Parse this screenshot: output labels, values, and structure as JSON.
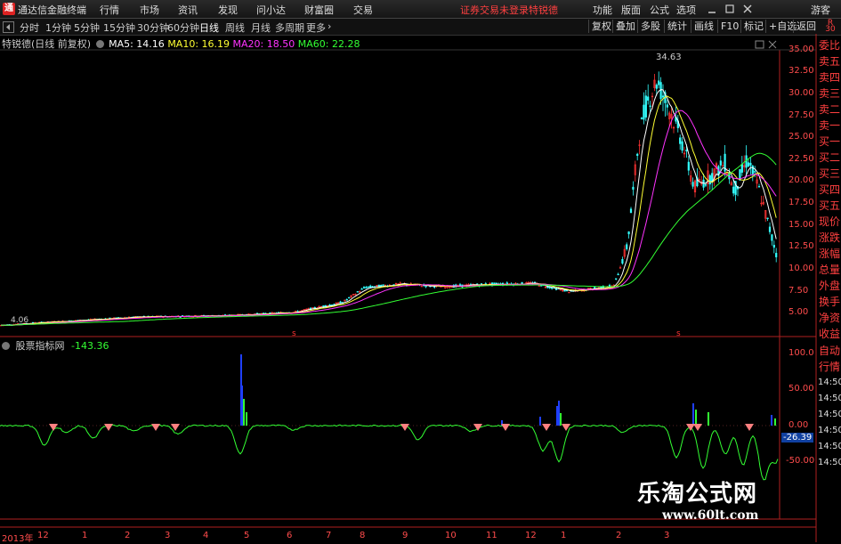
{
  "app": {
    "title": "通达信金融终端",
    "logo_char": "通"
  },
  "menu": {
    "items": [
      "行情",
      "市场",
      "资讯",
      "发现",
      "问小达",
      "财富圈",
      "交易"
    ],
    "notice": "证券交易未登录",
    "stock_name": "特锐德",
    "right_items": [
      "功能",
      "版面",
      "公式",
      "选项",
      "游客"
    ]
  },
  "periods": {
    "items": [
      "分时",
      "1分钟",
      "5分钟",
      "15分钟",
      "30分钟",
      "60分钟",
      "日线",
      "周线",
      "月线",
      "多周期",
      "更多"
    ],
    "selected": "日线"
  },
  "toolbar_right": [
    "复权",
    "叠加",
    "多股",
    "统计",
    "画线",
    "F10",
    "标记",
    "+自选",
    "返回"
  ],
  "main_chart": {
    "title": "特锐德(日线 前复权)",
    "indicators": [
      {
        "label": "MA5: 14.16",
        "color": "#ffffff"
      },
      {
        "label": "MA10: 16.19",
        "color": "#ffff33"
      },
      {
        "label": "MA20: 18.50",
        "color": "#ff33ff"
      },
      {
        "label": "MA60: 22.28",
        "color": "#33ff33"
      }
    ],
    "peak_label": "34.63",
    "low_label": "4.06",
    "y_ticks": [
      "35.00",
      "32.50",
      "30.00",
      "27.50",
      "25.00",
      "22.50",
      "20.00",
      "17.50",
      "15.00",
      "12.50",
      "10.00",
      "7.50",
      "5.00"
    ]
  },
  "sub_chart": {
    "title": "股票指标网",
    "value": "-143.36",
    "y_ticks": [
      "100.0",
      "50.00",
      "0.00",
      "-50.00"
    ],
    "current_value": "-26.39"
  },
  "side_labels": [
    "委比",
    "卖五",
    "卖四",
    "卖三",
    "卖二",
    "卖一",
    "买一",
    "买二",
    "买三",
    "买四",
    "买五",
    "现价",
    "涨跌",
    "涨幅",
    "总量",
    "外盘",
    "换手",
    "净资",
    "收益"
  ],
  "sub_side_labels": [
    "自动",
    "行情",
    "14:50",
    "14:50",
    "14:50",
    "14:50",
    "14:50",
    "14:50"
  ],
  "x_axis": [
    "2013年",
    "12",
    "1",
    "2",
    "3",
    "4",
    "5",
    "6",
    "7",
    "8",
    "9",
    "10",
    "11",
    "12",
    "1",
    "2",
    "3"
  ],
  "watermark": {
    "line1": "乐淘公式网",
    "line2": "www.60lt.com"
  },
  "colors": {
    "up": "#ff3333",
    "down": "#33ffff",
    "ma5": "#ffffff",
    "ma10": "#ffff33",
    "ma20": "#ff33ff",
    "ma60": "#33ff33",
    "axis": "#b02020"
  }
}
